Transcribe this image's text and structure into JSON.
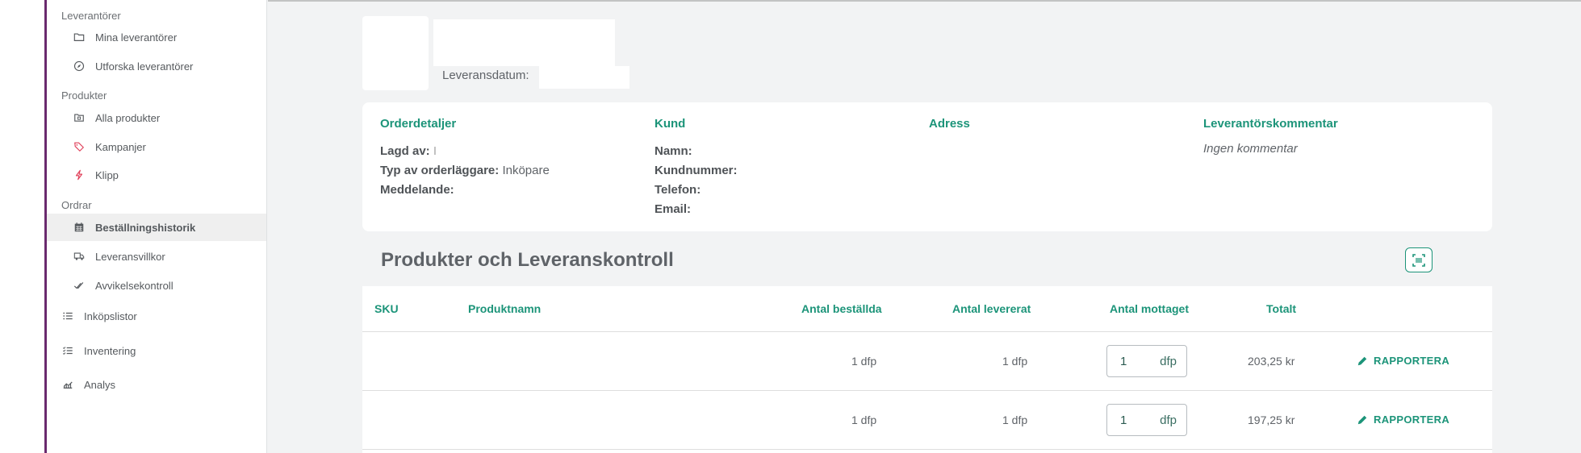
{
  "sidebar": {
    "sections": [
      {
        "label": "Leverantörer"
      },
      {
        "label": "Produkter"
      },
      {
        "label": "Ordrar"
      }
    ],
    "items": [
      {
        "label": "Mina leverantörer",
        "icon": "folder-icon"
      },
      {
        "label": "Utforska leverantörer",
        "icon": "compass-icon"
      },
      {
        "label": "Alla produkter",
        "icon": "product-box-icon"
      },
      {
        "label": "Kampanjer",
        "icon": "tag-icon"
      },
      {
        "label": "Klipp",
        "icon": "flash-icon"
      },
      {
        "label": "Beställningshistorik",
        "icon": "calendar-icon",
        "active": true
      },
      {
        "label": "Leveransvillkor",
        "icon": "truck-icon"
      },
      {
        "label": "Avvikelsekontroll",
        "icon": "double-check-icon"
      },
      {
        "label": "Inköpslistor",
        "icon": "list-icon"
      },
      {
        "label": "Inventering",
        "icon": "checklist-icon"
      },
      {
        "label": "Analys",
        "icon": "analytics-icon"
      }
    ]
  },
  "header": {
    "delivery_label": "Leveransdatum:"
  },
  "order": {
    "details": {
      "title": "Orderdetaljer",
      "made_by_label": "Lagd av:",
      "made_by_value": "I",
      "type_label": "Typ av orderläggare:",
      "type_value": "Inköpare",
      "message_label": "Meddelande:"
    },
    "customer": {
      "title": "Kund",
      "name_label": "Namn:",
      "number_label": "Kundnummer:",
      "phone_label": "Telefon:",
      "email_label": "Email:"
    },
    "address": {
      "title": "Adress"
    },
    "supplier_comment": {
      "title": "Leverantörskommentar",
      "value": "Ingen kommentar"
    }
  },
  "products": {
    "section_title": "Produkter och Leveranskontroll",
    "columns": {
      "sku": "SKU",
      "name": "Produktnamn",
      "ordered": "Antal beställda",
      "delivered": "Antal levererat",
      "received": "Antal mottaget",
      "total": "Totalt"
    },
    "rows": [
      {
        "ordered": "1 dfp",
        "delivered": "1 dfp",
        "received_value": "1",
        "received_unit": "dfp",
        "total": "203,25 kr",
        "action": "RAPPORTERA"
      },
      {
        "ordered": "1 dfp",
        "delivered": "1 dfp",
        "received_value": "1",
        "received_unit": "dfp",
        "total": "197,25 kr",
        "action": "RAPPORTERA"
      }
    ]
  },
  "colors": {
    "accent": "#1c9479",
    "brand_bar": "#6a2a6e",
    "campaign_icon": "#e0405a"
  }
}
